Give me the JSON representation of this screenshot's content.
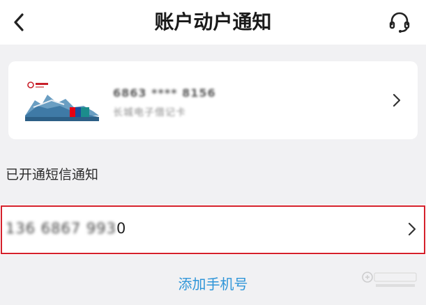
{
  "header": {
    "title": "账户动户通知",
    "back_icon": "chevron-left-icon",
    "support_icon": "headset-icon"
  },
  "card": {
    "number_masked": "6863 **** 8156",
    "card_type": "长城电子借记卡",
    "image_icon": "bank-card-icon",
    "chevron_icon": "chevron-right-icon"
  },
  "section_label": "已开通短信通知",
  "phone": {
    "masked_part": "136 6867 993",
    "last_digit": "0",
    "chevron_icon": "chevron-right-icon",
    "highlight_color": "#d5202b"
  },
  "add_phone_label": "添加手机号",
  "colors": {
    "accent": "#2f95d8",
    "background": "#f1f1f3"
  }
}
